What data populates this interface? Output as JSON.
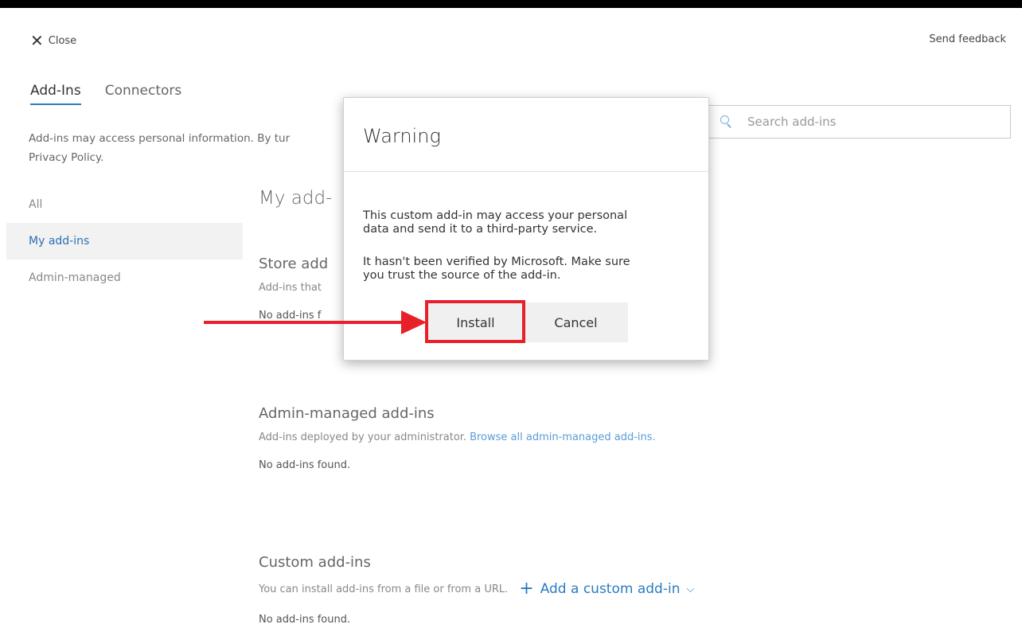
{
  "header": {
    "close_label": "Close",
    "feedback_label": "Send feedback"
  },
  "tabs": [
    {
      "label": "Add-Ins",
      "active": true
    },
    {
      "label": "Connectors",
      "active": false
    }
  ],
  "notice": {
    "line1": "Add-ins may access personal information. By tur",
    "line2": "Privacy Policy."
  },
  "search": {
    "placeholder": "Search add-ins",
    "icon": "search-icon"
  },
  "nav": {
    "items": [
      {
        "label": "All"
      },
      {
        "label": "My add-ins",
        "selected": true
      },
      {
        "label": "Admin-managed"
      }
    ]
  },
  "main": {
    "title": "My add-",
    "store": {
      "title": "Store add",
      "desc": "Add-ins that",
      "empty": "No add-ins f"
    },
    "admin": {
      "title": "Admin-managed add-ins",
      "desc": "Add-ins deployed by your administrator.",
      "link": "Browse all admin-managed add-ins.",
      "empty": "No add-ins found."
    },
    "custom": {
      "title": "Custom add-ins",
      "desc": "You can install add-ins from a file or from a URL.",
      "add_label": "Add a custom add-in",
      "empty": "No add-ins found."
    }
  },
  "dialog": {
    "title": "Warning",
    "para1_line1": "This custom add-in may access your personal",
    "para1_line2": "data and send it to a third-party service.",
    "para2_line1": "It hasn't been verified by Microsoft. Make sure",
    "para2_line2": "you trust the source of the add-in.",
    "install_label": "Install",
    "cancel_label": "Cancel"
  },
  "colors": {
    "accent": "#2b7bc1",
    "annotation": "#e8202a"
  }
}
